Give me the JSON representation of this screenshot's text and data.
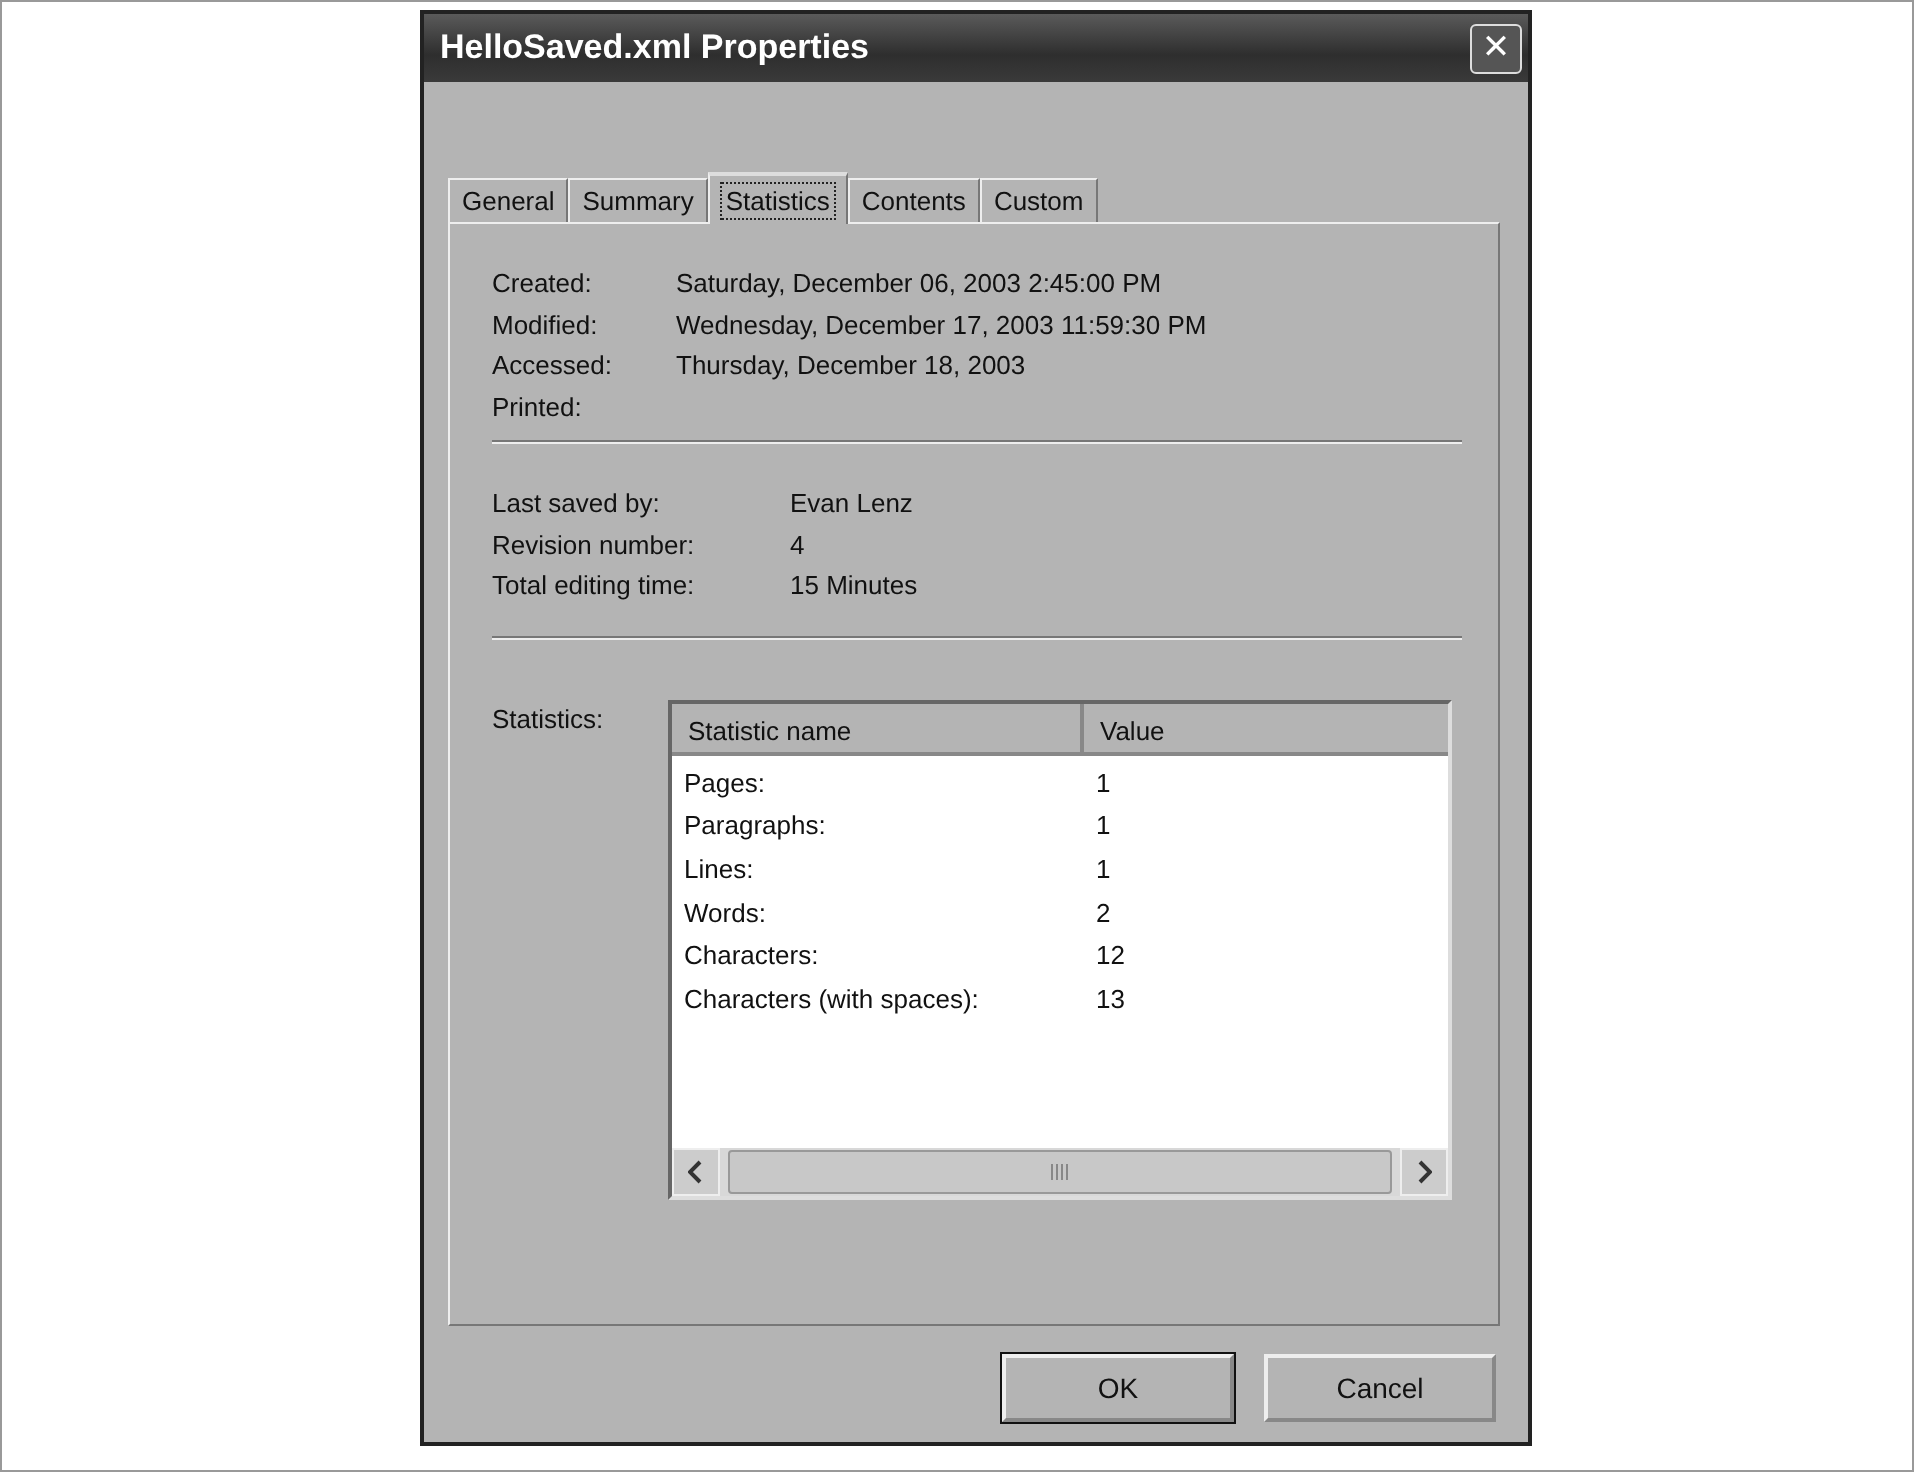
{
  "window": {
    "title": "HelloSaved.xml Properties",
    "close": "✕"
  },
  "tabs": [
    {
      "label": "General",
      "selected": false
    },
    {
      "label": "Summary",
      "selected": false
    },
    {
      "label": "Statistics",
      "selected": true
    },
    {
      "label": "Contents",
      "selected": false
    },
    {
      "label": "Custom",
      "selected": false
    }
  ],
  "dates": [
    {
      "label": "Created:",
      "value": "Saturday, December 06, 2003 2:45:00 PM"
    },
    {
      "label": "Modified:",
      "value": "Wednesday, December 17, 2003 11:59:30 PM"
    },
    {
      "label": "Accessed:",
      "value": "Thursday, December 18, 2003"
    },
    {
      "label": "Printed:"
    }
  ],
  "info": [
    {
      "label": "Last saved by:",
      "value": "Evan Lenz"
    },
    {
      "label": "Revision number:",
      "value": "4"
    },
    {
      "label": "Total editing time:",
      "value": "15 Minutes"
    }
  ],
  "statistics": {
    "label": "Statistics:",
    "columns": [
      "Statistic name",
      "Value"
    ],
    "rows": [
      {
        "name": "Pages:",
        "value": "1"
      },
      {
        "name": "Paragraphs:",
        "value": "1"
      },
      {
        "name": "Lines:",
        "value": "1"
      },
      {
        "name": "Words:",
        "value": "2"
      },
      {
        "name": "Characters:",
        "value": "12"
      },
      {
        "name": "Characters (with spaces):",
        "value": "13"
      }
    ]
  },
  "buttons": [
    {
      "label": "OK",
      "default": true
    },
    {
      "label": "Cancel",
      "default": false
    }
  ]
}
